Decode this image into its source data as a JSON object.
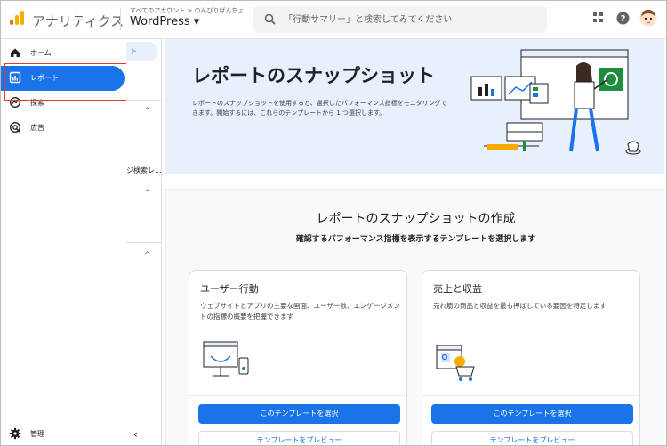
{
  "header": {
    "app_name": "アナリティクス",
    "account_crumb": "すべてのアカウント > のんびりばんちょ",
    "property": "WordPress ▾",
    "search_placeholder": "「行動サマリー」と検索してみてください"
  },
  "nav": {
    "items": [
      {
        "label": "ホーム",
        "icon": "home-icon"
      },
      {
        "label": "レポート",
        "icon": "reports-icon",
        "active": true
      },
      {
        "label": "探索",
        "icon": "explore-icon"
      },
      {
        "label": "広告",
        "icon": "advertising-icon"
      }
    ],
    "admin_label": "管理"
  },
  "subpanel": {
    "chip_text": "ト",
    "truncated_text": "ジ検索レ..."
  },
  "banner": {
    "title": "レポートのスナップショット",
    "description": "レポートのスナップショットを使用すると、選択したパフォーマンス指標をモニタリングできます。開始するには、これらのテンプレートから 1 つ選択します。"
  },
  "create": {
    "title": "レポートのスナップショットの作成",
    "subtitle": "確認するパフォーマンス指標を表示するテンプレートを選択します"
  },
  "cards": [
    {
      "title": "ユーザー行動",
      "description": "ウェブサイトとアプリの主要な画面、ユーザー数、エンゲージメントの指標の概要を把握できます",
      "primary_label": "このテンプレートを選択",
      "secondary_label": "テンプレートをプレビュー"
    },
    {
      "title": "売上と収益",
      "description": "売れ筋の商品と収益を最も押ばしている要因を特定します",
      "primary_label": "このテンプレートを選択",
      "secondary_label": "テンプレートをプレビュー"
    }
  ],
  "colors": {
    "accent": "#1a73e8",
    "banner_bg": "#e8f0fe",
    "highlight": "#e53935",
    "logo_orange": "#f9ab00",
    "logo_dark": "#e37400"
  }
}
